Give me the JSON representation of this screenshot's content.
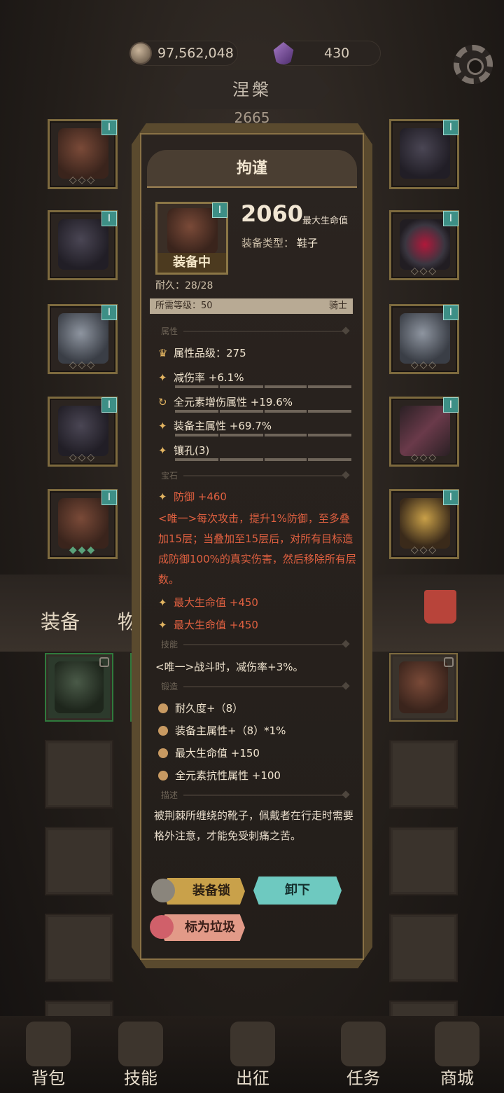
{
  "currency": {
    "gold": "97,562,048",
    "gems": "430"
  },
  "character": {
    "name": "涅槃",
    "power": "2665"
  },
  "tabs": {
    "equipment": "装备",
    "items": "物品"
  },
  "item": {
    "name": "拘谨",
    "equipped_tag": "装备中",
    "main_value": "2060",
    "main_label": "最大生命值",
    "type_label": "装备类型：",
    "type_value": "鞋子",
    "level_badge": "Ⅰ",
    "durability": "耐久：28/28",
    "required_level": "所需等级：50",
    "class": "骑士",
    "sections": {
      "attributes": "属性",
      "gems": "宝石",
      "skills": "技能",
      "forge": "锻造",
      "description": "描述"
    },
    "quality": "属性品级：275",
    "affixes": [
      "减伤率 +6.1%",
      "全元素增伤属性 +19.6%",
      "装备主属性 +69.7%",
      "镶孔(3)"
    ],
    "gems": {
      "first": "防御 +460",
      "unique": "<唯一>每次攻击，提升1%防御，至多叠加15层；当叠加至15层后，对所有目标造成防御100%的真实伤害，然后移除所有层数。",
      "second": "最大生命值 +450",
      "third": "最大生命值 +450"
    },
    "skill": "<唯一>战斗时，减伤率+3%。",
    "forge": [
      "耐久度+（8）",
      "装备主属性+（8）*1%",
      "最大生命值 +150",
      "全元素抗性属性 +100"
    ],
    "description": "被荆棘所缠绕的靴子，佩戴者在行走时需要格外注意，才能免受刺痛之苦。"
  },
  "buttons": {
    "lock": "装备锁",
    "unequip": "卸下",
    "trash": "标为垃圾"
  },
  "nav": [
    "背包",
    "技能",
    "出征",
    "任务",
    "商城"
  ]
}
